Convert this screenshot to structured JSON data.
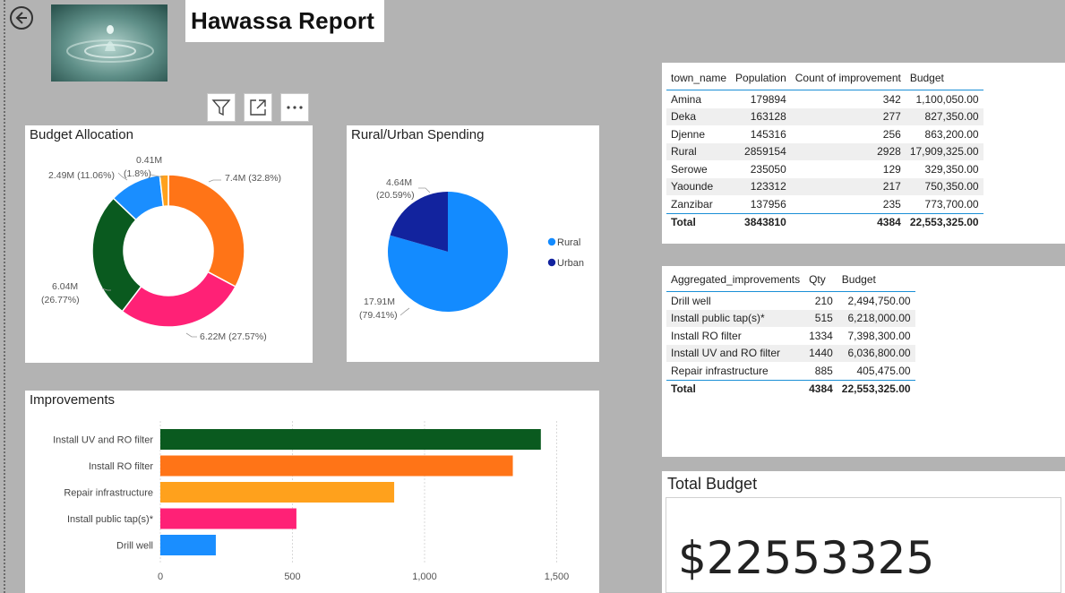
{
  "report": {
    "title": "Hawassa Report"
  },
  "toolbar": {
    "filter_icon": "filter-icon",
    "focus_icon": "focus-mode-icon",
    "more_icon": "more-options-icon"
  },
  "budget_allocation": {
    "title": "Budget Allocation",
    "labels": [
      {
        "value": "7.4M",
        "pct": "(32.8%)"
      },
      {
        "value": "6.22M",
        "pct": "(27.57%)"
      },
      {
        "value": "6.04M",
        "pct": "(26.77%)"
      },
      {
        "value": "2.49M",
        "pct": "(11.06%)"
      },
      {
        "value": "0.41M",
        "pct": "(1.8%)"
      }
    ]
  },
  "rural_urban": {
    "title": "Rural/Urban Spending",
    "labels": [
      {
        "value": "17.91M",
        "pct": "(79.41%)"
      },
      {
        "value": "4.64M",
        "pct": "(20.59%)"
      }
    ],
    "legend": [
      "Rural",
      "Urban"
    ]
  },
  "improvements": {
    "title": "Improvements",
    "ticks": [
      "0",
      "500",
      "1,000",
      "1,500"
    ]
  },
  "town_table": {
    "headers": [
      "town_name",
      "Population",
      "Count of improvement",
      "Budget"
    ],
    "rows": [
      [
        "Amina",
        "179894",
        "342",
        "1,100,050.00"
      ],
      [
        "Deka",
        "163128",
        "277",
        "827,350.00"
      ],
      [
        "Djenne",
        "145316",
        "256",
        "863,200.00"
      ],
      [
        "Rural",
        "2859154",
        "2928",
        "17,909,325.00"
      ],
      [
        "Serowe",
        "235050",
        "129",
        "329,350.00"
      ],
      [
        "Yaounde",
        "123312",
        "217",
        "750,350.00"
      ],
      [
        "Zanzibar",
        "137956",
        "235",
        "773,700.00"
      ]
    ],
    "total": [
      "Total",
      "3843810",
      "4384",
      "22,553,325.00"
    ]
  },
  "improvement_table": {
    "headers": [
      "Aggregated_improvements",
      "Qty",
      "Budget"
    ],
    "rows": [
      [
        "Drill well",
        "210",
        "2,494,750.00"
      ],
      [
        "Install public tap(s)*",
        "515",
        "6,218,000.00"
      ],
      [
        "Install RO filter",
        "1334",
        "7,398,300.00"
      ],
      [
        "Install UV and RO filter",
        "1440",
        "6,036,800.00"
      ],
      [
        "Repair infrastructure",
        "885",
        "405,475.00"
      ]
    ],
    "total": [
      "Total",
      "4384",
      "22,553,325.00"
    ]
  },
  "total_budget": {
    "title": "Total Budget",
    "value": "$22553325"
  },
  "chart_data": [
    {
      "type": "pie",
      "title": "Budget Allocation",
      "donut": true,
      "values": [
        7.4,
        6.22,
        6.04,
        2.49,
        0.41
      ],
      "percentages": [
        32.8,
        27.57,
        26.77,
        11.06,
        1.8
      ],
      "colors": [
        "#ff7417",
        "#ff2176",
        "#0a5a1f",
        "#1a8eff",
        "#ffa11c"
      ]
    },
    {
      "type": "pie",
      "title": "Rural/Urban Spending",
      "categories": [
        "Rural",
        "Urban"
      ],
      "values": [
        17.91,
        4.64
      ],
      "percentages": [
        79.41,
        20.59
      ],
      "colors": [
        "#138bff",
        "#12239e"
      ],
      "legend_position": "right"
    },
    {
      "type": "bar",
      "orientation": "horizontal",
      "title": "Improvements",
      "categories": [
        "Install UV and RO filter",
        "Install RO filter",
        "Repair infrastructure",
        "Install public tap(s)*",
        "Drill well"
      ],
      "values": [
        1440,
        1334,
        885,
        515,
        210
      ],
      "colors": [
        "#0a5a1f",
        "#ff7417",
        "#ffa11c",
        "#ff2176",
        "#1a8eff"
      ],
      "xlim": [
        0,
        1500
      ],
      "xticks": [
        0,
        500,
        1000,
        1500
      ],
      "grid": true
    }
  ]
}
